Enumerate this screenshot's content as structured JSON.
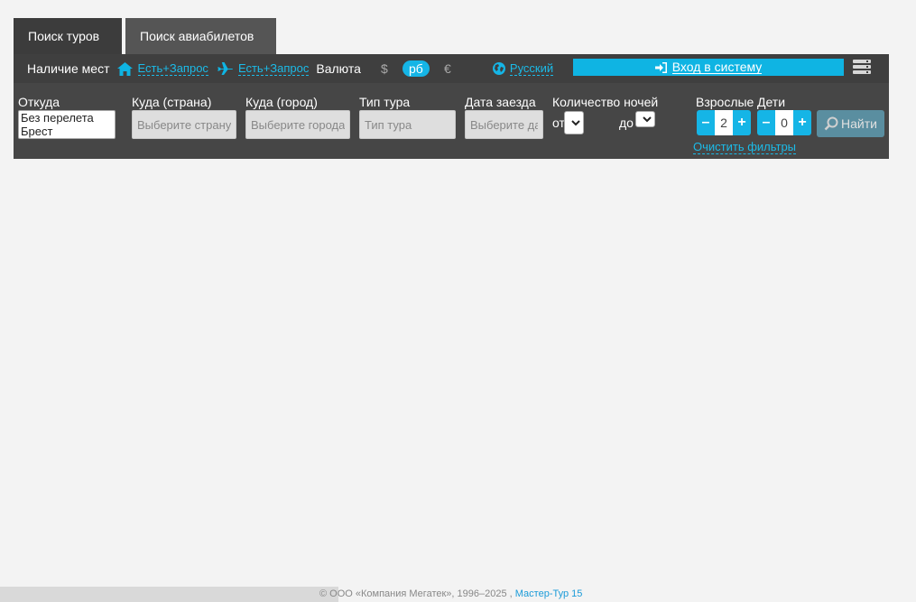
{
  "tabs": [
    {
      "label": "Поиск туров",
      "active": true
    },
    {
      "label": "Поиск авиабилетов",
      "active": false
    }
  ],
  "topbar": {
    "availability_label": "Наличие мест",
    "hotel_availability": "Есть+Запрос",
    "flight_availability": "Есть+Запрос",
    "currency_label": "Валюта",
    "currencies": [
      "$",
      "рб",
      "€"
    ],
    "selected_currency": "рб",
    "language": "Русский",
    "login_label": "Вход в систему",
    "accent_color": "#15b5e6"
  },
  "filters": {
    "from": {
      "label": "Откуда",
      "options": [
        "Без перелета",
        "Брест"
      ]
    },
    "country": {
      "label": "Куда (страна)",
      "placeholder": "Выберите страну"
    },
    "city": {
      "label": "Куда (город)",
      "placeholder": "Выберите города"
    },
    "tour_type": {
      "label": "Тип тура",
      "placeholder": "Тип тура"
    },
    "date": {
      "label": "Дата заезда",
      "placeholder": "Выберите дату"
    },
    "nights": {
      "label": "Количество ночей",
      "from_label": "от",
      "to_label": "до"
    },
    "adults": {
      "label": "Взрослые",
      "value": "2"
    },
    "children": {
      "label": "Дети",
      "value": "0"
    },
    "find_label": "Найти",
    "clear_label": "Очистить фильтры"
  },
  "footer": {
    "copyright": "© ООО «Компания Мегатек», 1996–2025 ,",
    "product": "Мастер-Тур 15"
  }
}
